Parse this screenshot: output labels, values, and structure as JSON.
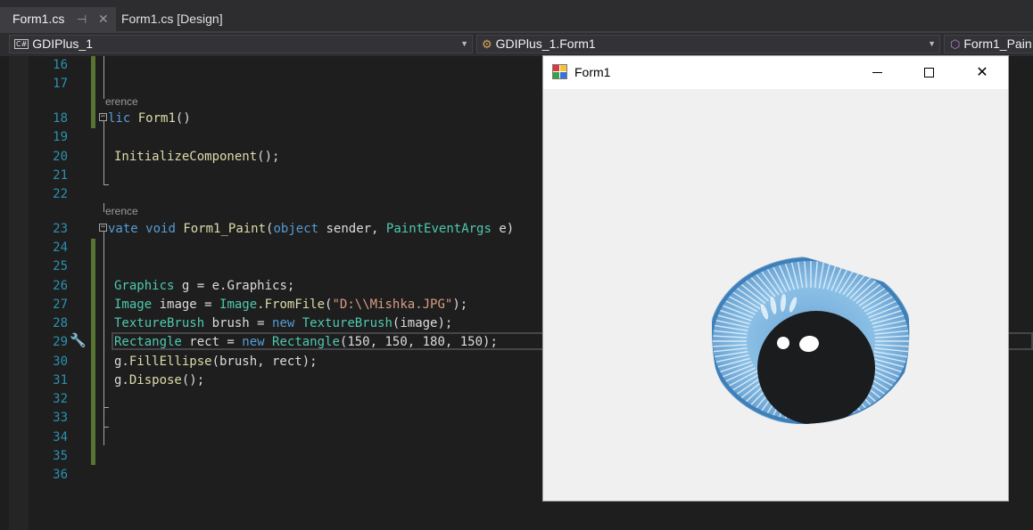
{
  "tabs": [
    {
      "label": "Form1.cs",
      "pin": "⊣",
      "close": "✕"
    },
    {
      "label": "Form1.cs [Design]"
    }
  ],
  "navbar": {
    "project": "GDIPlus_1",
    "project_icon_text": "C#",
    "class": "GDIPlus_1.Form1",
    "member": "Form1_Pain"
  },
  "editor": {
    "line_numbers": [
      "16",
      "17",
      "18",
      "19",
      "20",
      "21",
      "22",
      "23",
      "24",
      "25",
      "26",
      "27",
      "28",
      "29",
      "30",
      "31",
      "32",
      "33",
      "34",
      "35",
      "36"
    ],
    "codelens": [
      "erence",
      "erence"
    ]
  },
  "form_window": {
    "title": "Form1",
    "minimize_label": "Minimize",
    "maximize_label": "Maximize",
    "close_label": "Close"
  },
  "colors": {
    "keyword": "#569cd6",
    "type": "#4ec9b0",
    "method": "#dcdcaa",
    "string": "#d69d85",
    "line_number": "#2b91af",
    "change_bar": "#577430"
  },
  "icons": {
    "tab_pin": "pin-icon",
    "tab_close": "close-icon",
    "project": "csharp-project-icon",
    "class": "namespace-class-icon",
    "member": "method-cube-icon",
    "quick_action": "screwdriver-icon",
    "form_app": "windows-form-icon"
  }
}
